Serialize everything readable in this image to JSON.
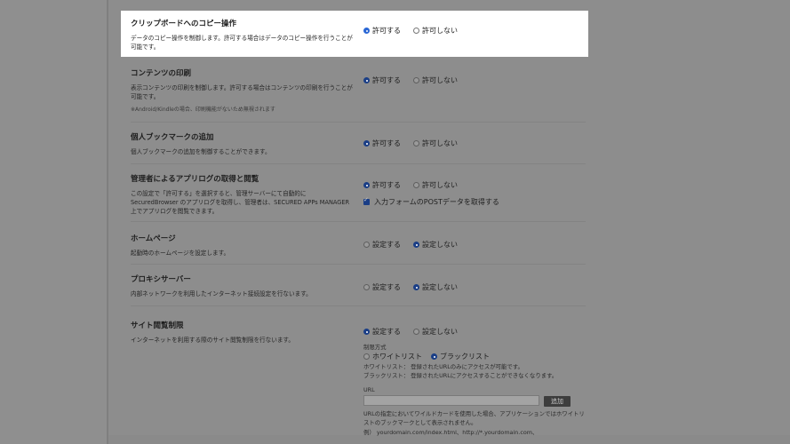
{
  "settings": [
    {
      "title": "クリップボードへのコピー操作",
      "desc": "データのコピー操作を制御します。許可する場合はデータのコピー操作を行うことが可能です。",
      "options": [
        "許可する",
        "許可しない"
      ],
      "selected": 0
    },
    {
      "title": "コンテンツの印刷",
      "desc": "表示コンテンツの印刷を制御します。許可する場合はコンテンツの印刷を行うことが可能です。",
      "note": "※Android/Kindleの場合、印刷機能がないため無視されます",
      "options": [
        "許可する",
        "許可しない"
      ],
      "selected": 0
    },
    {
      "title": "個人ブックマークの追加",
      "desc": "個人ブックマークの追加を制御することができます。",
      "options": [
        "許可する",
        "許可しない"
      ],
      "selected": 0
    },
    {
      "title": "管理者によるアプリログの取得と閲覧",
      "desc": "この設定で「許可する」を選択すると、管理サーバーにて自動的にSecuredBrowser のアプリログを取得し、管理者は、SECURED APPs MANAGER 上でアプリログを閲覧できます。",
      "options": [
        "許可する",
        "許可しない"
      ],
      "selected": 0,
      "checkbox_label": "入力フォームのPOSTデータを取得する"
    },
    {
      "title": "ホームページ",
      "desc": "起動時のホームページを設定します。",
      "options": [
        "設定する",
        "設定しない"
      ],
      "selected": 1
    },
    {
      "title": "プロキシサーバー",
      "desc": "内部ネットワークを利用したインターネット接続設定を行ないます。",
      "options": [
        "設定する",
        "設定しない"
      ],
      "selected": 1
    },
    {
      "title": "サイト閲覧制限",
      "desc": "インターネットを利用する際のサイト閲覧制限を行ないます。",
      "options": [
        "設定する",
        "設定しない"
      ],
      "selected": 0
    }
  ],
  "restriction": {
    "method_label": "制限方式",
    "methods": [
      "ホワイトリスト",
      "ブラックリスト"
    ],
    "method_selected": 1,
    "whitelist_help": "ホワイトリスト： 登録されたURLのみにアクセスが可能です。",
    "blacklist_help": "ブラックリスト： 登録されたURLにアクセスすることができなくなります。",
    "url_label": "URL",
    "add_button": "追加",
    "url_help": "URLの指定においてワイルドカードを使用した場合、アプリケーションではホワイトリストのブックマークとして表示されません。",
    "example": "例） yourdomain.com/index.html、http://*.yourdomain.com、"
  },
  "colors": {
    "overlay": "#8c8c8c",
    "highlight": "#ffffff",
    "accent": "#2a67d5"
  }
}
